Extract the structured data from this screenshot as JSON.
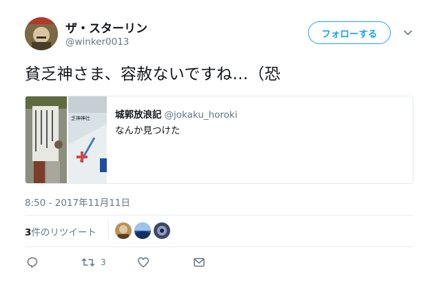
{
  "user": {
    "display_name": "ザ・スターリン",
    "handle": "@winker0013"
  },
  "follow_button": {
    "label": "フォローする"
  },
  "tweet": {
    "text": "貧乏神さま、容赦ないですね…（恐"
  },
  "quoted_tweet": {
    "author_name": "城郭放浪記",
    "author_handle": "@jokaku_horoki",
    "text": "なんか見つけた",
    "media_text": "乏神神社"
  },
  "timestamp": "8:50 - 2017年11月11日",
  "retweets": {
    "count": "3",
    "label": "件のリツイート"
  },
  "actions": {
    "retweet_count": "3"
  },
  "colors": {
    "accent": "#1da1f2",
    "secondary_text": "#657786",
    "primary_text": "#14171a",
    "border": "#e1e8ed"
  }
}
